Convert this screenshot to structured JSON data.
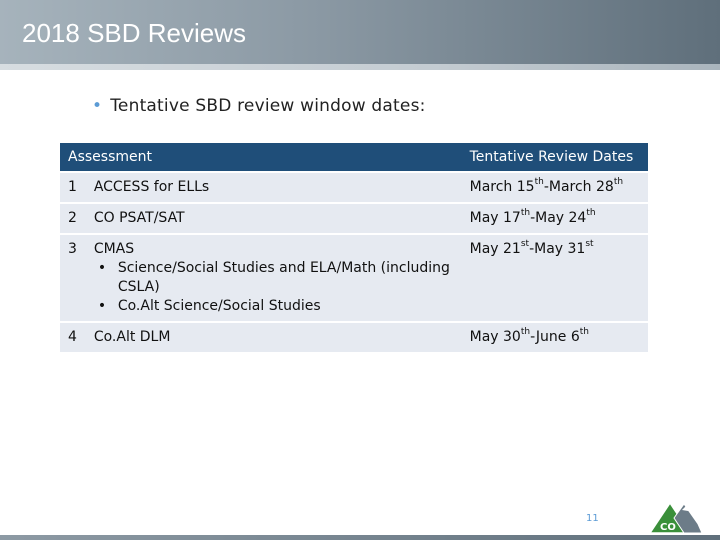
{
  "slide": {
    "title": "2018 SBD Reviews",
    "bullet": "Tentative SBD review window dates:",
    "page_number": "11"
  },
  "table": {
    "headers": [
      "Assessment",
      "Tentative Review Dates"
    ],
    "rows": [
      {
        "num": "1",
        "name": "ACCESS for ELLs",
        "items": [],
        "date": {
          "m1": "March 15",
          "s1": "th",
          "sep": "-March 28",
          "s2": "th"
        }
      },
      {
        "num": "2",
        "name": "CO PSAT/SAT",
        "items": [],
        "date": {
          "m1": "May 17",
          "s1": "th",
          "sep": "-May 24",
          "s2": "th"
        }
      },
      {
        "num": "3",
        "name": "CMAS",
        "items": [
          "Science/Social Studies and ELA/Math (including CSLA)",
          "Co.Alt Science/Social Studies"
        ],
        "date": {
          "m1": "May 21",
          "s1": "st",
          "sep": "-May 31",
          "s2": "st"
        }
      },
      {
        "num": "4",
        "name": "Co.Alt DLM",
        "items": [],
        "date": {
          "m1": "May 30",
          "s1": "th",
          "sep": "-June 6",
          "s2": "th"
        }
      }
    ]
  },
  "logo": {
    "text": "CO",
    "icon": "colorado-department-of-education-logo"
  },
  "colors": {
    "header_fill": "#1f4e79",
    "row_fill": "#e6eaf1",
    "accent": "#5b9bd5",
    "logo_green": "#3a8f3a"
  }
}
